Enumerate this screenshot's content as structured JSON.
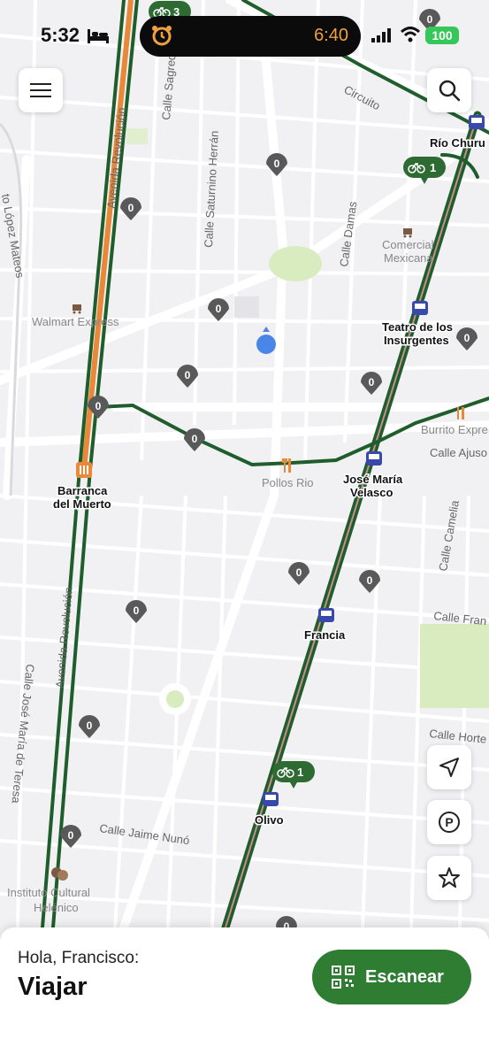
{
  "status_bar": {
    "time": "5:32",
    "island_time": "6:40",
    "battery": "100",
    "icons": [
      "bed-icon",
      "alarm-icon",
      "signal-icon",
      "wifi-icon",
      "battery-icon"
    ]
  },
  "map": {
    "streets": {
      "av_revolucion_1": "Avenida Revolución",
      "av_revolucion_2": "Avenida Revolución",
      "sagredo": "Calle Sagredo",
      "saturnino": "Calle Saturnino Herrán",
      "damas": "Calle Damas",
      "circuito": "Circuito",
      "lopez_mateos": "to López Mateos",
      "camelia": "Calle Camelia",
      "frans": "Calle Fran",
      "horte": "Calle Horte",
      "jaime_nuno": "Calle Jaime Nunó",
      "jose_maria_teresa": "Calle José María de Teresa",
      "ajuso": "Calle Ajuso"
    },
    "places": {
      "walmart": "Walmart Express",
      "comercial_1": "Comercial",
      "comercial_2": "Mexicana",
      "pollos_rio": "Pollos Rio",
      "burrito": "Burrito Expre",
      "instituto_1": "Instituto Cultural",
      "instituto_2": "Helénico"
    },
    "stations": {
      "rio_churu": "Río Churu",
      "teatro_1": "Teatro de los",
      "teatro_2": "Insurgentes",
      "barranca_1": "Barranca",
      "barranca_2": "del Muerto",
      "jose_1": "José María",
      "jose_2": "Velasco",
      "francia": "Francia",
      "olivo": "Olivo"
    },
    "pins": {
      "zero": "0",
      "bike_top": "3",
      "bike_rio": "1",
      "bike_olivo": "1"
    },
    "colors": {
      "route": "#1f5e2c",
      "orange_line": "#e8893a",
      "map_bg": "#f1f1f4",
      "street": "#ffffff",
      "park": "#d8ecc0",
      "pin": "#555555",
      "location": "#4a86e8"
    }
  },
  "controls": {
    "menu": "menu-icon",
    "search": "search-icon",
    "locate": "navigation-arrow-icon",
    "parking": "parking-icon",
    "favorite": "star-icon"
  },
  "sheet": {
    "greeting": "Hola, Francisco:",
    "title": "Viajar",
    "scan_label": "Escanear"
  }
}
